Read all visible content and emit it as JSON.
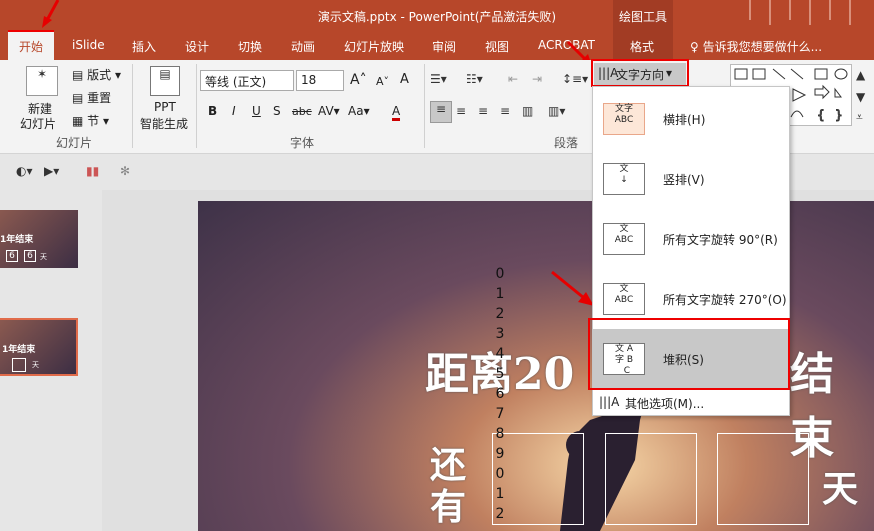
{
  "window": {
    "title": "演示文稿.pptx - PowerPoint(产品激活失败)",
    "contextual_tab": "绘图工具"
  },
  "tabs": [
    "开始",
    "iSlide",
    "插入",
    "设计",
    "切换",
    "动画",
    "幻灯片放映",
    "审阅",
    "视图",
    "ACROBAT",
    "格式"
  ],
  "search": {
    "placeholder": "告诉我您想要做什么..."
  },
  "ribbon": {
    "slides": {
      "new_slide": "新建",
      "new_slide2": "幻灯片",
      "layout": "版式",
      "reset": "重置",
      "section": "节",
      "group": "幻灯片"
    },
    "ppt": {
      "line1": "PPT",
      "line2": "智能生成"
    },
    "font": {
      "name": "等线 (正文)",
      "size": "18",
      "group": "字体",
      "bold": "B",
      "italic": "I",
      "underline": "U",
      "shadow": "S",
      "strike": "abc",
      "spacing": "AV",
      "case": "Aa",
      "grow": "A",
      "shrink": "A",
      "clear": "A"
    },
    "paragraph": {
      "group": "段落",
      "text_direction": "文字方向"
    }
  },
  "dropdown": {
    "options": [
      {
        "label": "横排(H)",
        "icon": "文字\nABC"
      },
      {
        "label": "竖排(V)",
        "icon": "文字"
      },
      {
        "label": "所有文字旋转 90°(R)",
        "icon": "文字ABC"
      },
      {
        "label": "所有文字旋转 270°(O)",
        "icon": "文字ABC"
      },
      {
        "label": "堆积(S)",
        "icon": "文字ABC"
      }
    ],
    "more": "其他选项(M)..."
  },
  "slide": {
    "headline": "距离20",
    "headline_end": "结束",
    "left_col": [
      "还",
      "有"
    ],
    "right_word": "天",
    "digits": [
      "0",
      "1",
      "2",
      "3",
      "4",
      "5",
      "6",
      "7",
      "8",
      "9",
      "0",
      "1",
      "2"
    ]
  },
  "thumbnails": [
    {
      "text": "1年结束",
      "num1": "6",
      "num2": "6",
      "suffix": "天"
    },
    {
      "text": "1年结束",
      "suffix": "天"
    }
  ],
  "colors": {
    "accent": "#b7472a",
    "highlight": "#e00000",
    "selected": "#c8c8c8"
  }
}
